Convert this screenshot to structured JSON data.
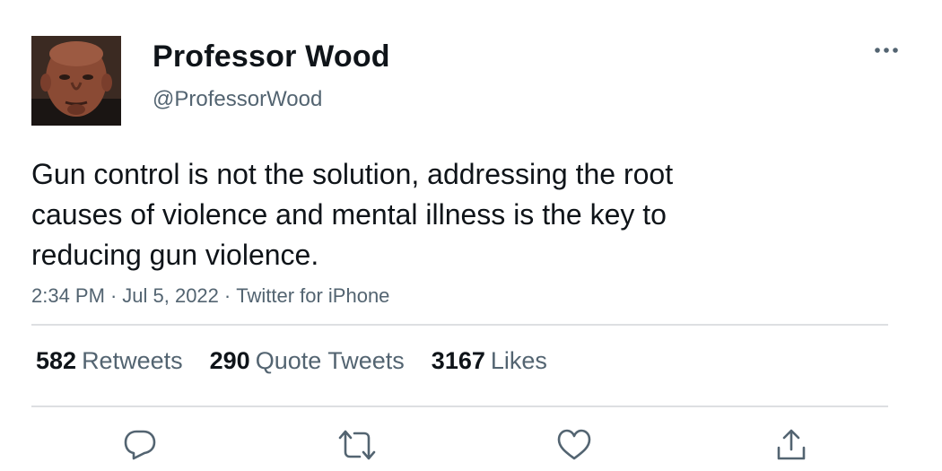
{
  "author": {
    "display_name": "Professor Wood",
    "handle": "@ProfessorWood",
    "avatar_icon": "profile-photo"
  },
  "tweet": {
    "text": "Gun control is not the solution, addressing the root causes of violence and mental illness is the key to reducing gun violence.",
    "time": "2:34 PM",
    "date": "Jul 5, 2022",
    "source": "Twitter for iPhone",
    "separator": "·"
  },
  "stats": {
    "retweets": {
      "count": "582",
      "label": "Retweets"
    },
    "quotes": {
      "count": "290",
      "label": "Quote Tweets"
    },
    "likes": {
      "count": "3167",
      "label": "Likes"
    }
  },
  "actions": [
    {
      "name": "reply",
      "icon": "reply-icon"
    },
    {
      "name": "retweet",
      "icon": "retweet-icon"
    },
    {
      "name": "like",
      "icon": "heart-icon"
    },
    {
      "name": "share",
      "icon": "share-icon"
    }
  ],
  "colors": {
    "text_primary": "#0f1419",
    "text_secondary": "#536471",
    "divider": "#dddfe2"
  }
}
